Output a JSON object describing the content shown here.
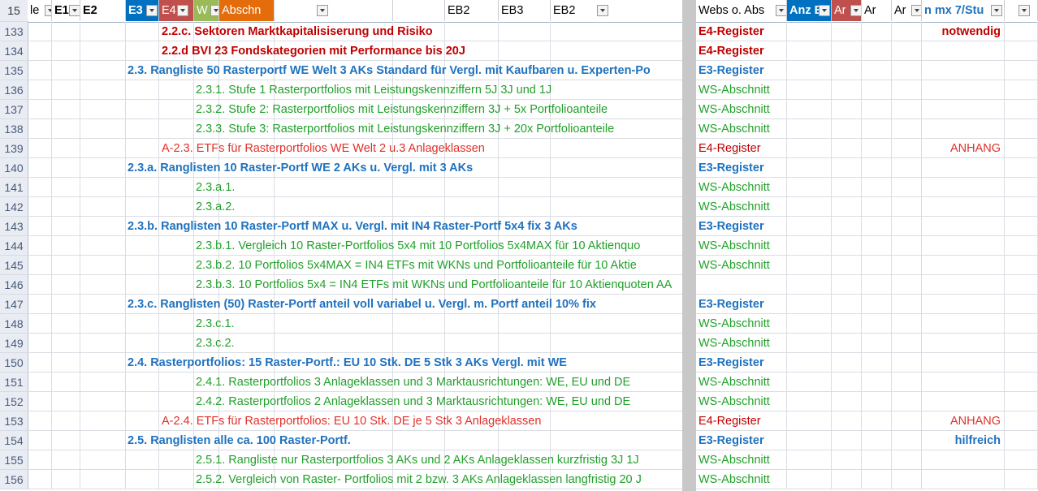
{
  "header": {
    "row_label": "15",
    "columns": [
      {
        "label": "le",
        "bg": "#ffffff",
        "color": "#000000"
      },
      {
        "label": "E1",
        "bg": "#ffffff",
        "color": "#000000"
      },
      {
        "label": "E2",
        "bg": "#ffffff",
        "color": "#000000"
      },
      {
        "label": "E3",
        "bg": "#0070c0",
        "color": "#ffffff"
      },
      {
        "label": "E4",
        "bg": "#c0504d",
        "color": "#ffffff"
      },
      {
        "label": "W",
        "bg": "#9bbb59",
        "color": "#ffffff"
      },
      {
        "label": "Abschn",
        "bg": "#e46c0a",
        "color": "#ffffff"
      },
      {
        "label": "",
        "bg": "#ffffff",
        "color": "#000000"
      },
      {
        "label": "",
        "bg": "#ffffff",
        "color": "#000000"
      },
      {
        "label": "EB2",
        "bg": "#ffffff",
        "color": "#000000"
      },
      {
        "label": "EB3",
        "bg": "#ffffff",
        "color": "#000000"
      },
      {
        "label": "EB2",
        "bg": "#ffffff",
        "color": "#000000"
      },
      {
        "label": "Webs o. Abs",
        "bg": "#ffffff",
        "color": "#000000"
      },
      {
        "label": "Anz E",
        "bg": "#0070c0",
        "color": "#ffffff"
      },
      {
        "label": "Ar",
        "bg": "#c0504d",
        "color": "#ffffff"
      },
      {
        "label": "Ar",
        "bg": "#ffffff",
        "color": "#000000"
      },
      {
        "label": "Ar",
        "bg": "#ffffff",
        "color": "#000000"
      },
      {
        "label": "n mx 7/Stu",
        "bg": "#ffffff",
        "color": "#1f72bf"
      },
      {
        "label": "",
        "bg": "#ffffff",
        "color": "#000000"
      }
    ]
  },
  "rows": [
    {
      "num": "133",
      "text": "2.2.c. Sektoren Marktkapitalisiserung und Risiko",
      "level": "E4",
      "type": "E4-Register",
      "note": "notwendig",
      "note_style": "red"
    },
    {
      "num": "134",
      "text": "2.2.d BVI 23 Fondskategorien mit Performance bis 20J",
      "level": "E4",
      "type": "E4-Register",
      "note": "",
      "note_style": ""
    },
    {
      "num": "135",
      "text": "2.3. Rangliste 50 Rasterportf WE Welt 3 AKs Standard für Vergl. mit Kaufbaren u. Experten-Po",
      "level": "E3",
      "type": "E3-Register",
      "note": "",
      "note_style": ""
    },
    {
      "num": "136",
      "text": "2.3.1. Stufe 1 Rasterportfolios mit Leistungskennziffern 5J 3J und 1J",
      "level": "WS",
      "type": "WS-Abschnitt",
      "note": "",
      "note_style": ""
    },
    {
      "num": "137",
      "text": "2.3.2. Stufe 2: Rasterportfolios mit Leistungskennziffern 3J + 5x Portfolioanteile",
      "level": "WS",
      "type": "WS-Abschnitt",
      "note": "",
      "note_style": ""
    },
    {
      "num": "138",
      "text": "2.3.3. Stufe 3: Rasterportfolios mit Leistungskennziffern 3J + 20x Portfolioanteile",
      "level": "WS",
      "type": "WS-Abschnitt",
      "note": "",
      "note_style": ""
    },
    {
      "num": "139",
      "text": "A-2.3. ETFs für Rasterportfolios WE Welt 2 u.3 Anlageklassen",
      "level": "A4",
      "type": "E4-Register",
      "note": "ANHANG",
      "note_style": "redl"
    },
    {
      "num": "140",
      "text": "2.3.a. Ranglisten 10 Raster-Portf WE 2 AKs u. Vergl. mit 3 AKs",
      "level": "E3",
      "type": "E3-Register",
      "note": "",
      "note_style": ""
    },
    {
      "num": "141",
      "text": "2.3.a.1.",
      "level": "WS",
      "type": "WS-Abschnitt",
      "note": "",
      "note_style": ""
    },
    {
      "num": "142",
      "text": "2.3.a.2.",
      "level": "WS",
      "type": "WS-Abschnitt",
      "note": "",
      "note_style": ""
    },
    {
      "num": "143",
      "text": "2.3.b. Ranglisten 10 Raster-Portf MAX u. Vergl. mit IN4 Raster-Portf 5x4 fix 3 AKs",
      "level": "E3",
      "type": "E3-Register",
      "note": "",
      "note_style": ""
    },
    {
      "num": "144",
      "text": "2.3.b.1. Vergleich 10 Raster-Portfolios 5x4 mit 10 Portfolios 5x4MAX für 10 Aktienquo",
      "level": "WS",
      "type": "WS-Abschnitt",
      "note": "",
      "note_style": ""
    },
    {
      "num": "145",
      "text": "2.3.b.2. 10 Portfolios 5x4MAX = IN4  ETFs mit WKNs und Portfolioanteile für 10 Aktie",
      "level": "WS",
      "type": "WS-Abschnitt",
      "note": "",
      "note_style": ""
    },
    {
      "num": "146",
      "text": "2.3.b.3. 10 Portfolios 5x4  = IN4 ETFs mit WKNs und Portfolioanteile für 10 Aktienquoten AA",
      "level": "WS",
      "type": "",
      "note": "",
      "note_style": ""
    },
    {
      "num": "147",
      "text": "2.3.c. Ranglisten (50) Raster-Portf  anteil voll variabel u. Vergl. m. Portf anteil 10% fix",
      "level": "E3",
      "type": "E3-Register",
      "note": "",
      "note_style": ""
    },
    {
      "num": "148",
      "text": "2.3.c.1.",
      "level": "WS",
      "type": "WS-Abschnitt",
      "note": "",
      "note_style": ""
    },
    {
      "num": "149",
      "text": "2.3.c.2.",
      "level": "WS",
      "type": "WS-Abschnitt",
      "note": "",
      "note_style": ""
    },
    {
      "num": "150",
      "text": "2.4. Rasterportfolios: 15 Raster-Portf.: EU 10 Stk. DE 5 Stk 3 AKs Vergl. mit WE",
      "level": "E3",
      "type": "E3-Register",
      "note": "",
      "note_style": ""
    },
    {
      "num": "151",
      "text": "2.4.1. Rasterportfolios 3 Anlageklassen  und 3 Marktausrichtungen: WE, EU und DE",
      "level": "WS",
      "type": "WS-Abschnitt",
      "note": "",
      "note_style": ""
    },
    {
      "num": "152",
      "text": "2.4.2. Rasterportfolios 2 Anlageklassen und 3 Marktausrichtungen: WE, EU und DE",
      "level": "WS",
      "type": "WS-Abschnitt",
      "note": "",
      "note_style": ""
    },
    {
      "num": "153",
      "text": "A-2.4. ETFs für Rasterportfolios: EU 10 Stk. DE je 5 Stk 3 Anlageklassen",
      "level": "A4",
      "type": "E4-Register",
      "note": "ANHANG",
      "note_style": "redl"
    },
    {
      "num": "154",
      "text": "2.5. Ranglisten alle ca. 100 Raster-Portf.",
      "level": "E3",
      "type": "E3-Register",
      "note": "hilfreich",
      "note_style": "blue"
    },
    {
      "num": "155",
      "text": "2.5.1. Rangliste nur Rasterportfolios 3 AKs und 2 AKs Anlageklassen kurzfristig 3J 1J",
      "level": "WS",
      "type": "WS-Abschnitt",
      "note": "",
      "note_style": ""
    },
    {
      "num": "156",
      "text": "2.5.2. Vergleich von Raster- Portfolios mit 2 bzw. 3 AKs Anlageklassen langfristig 20 J",
      "level": "WS",
      "type": "WS-Abschnitt",
      "note": "",
      "note_style": ""
    }
  ]
}
